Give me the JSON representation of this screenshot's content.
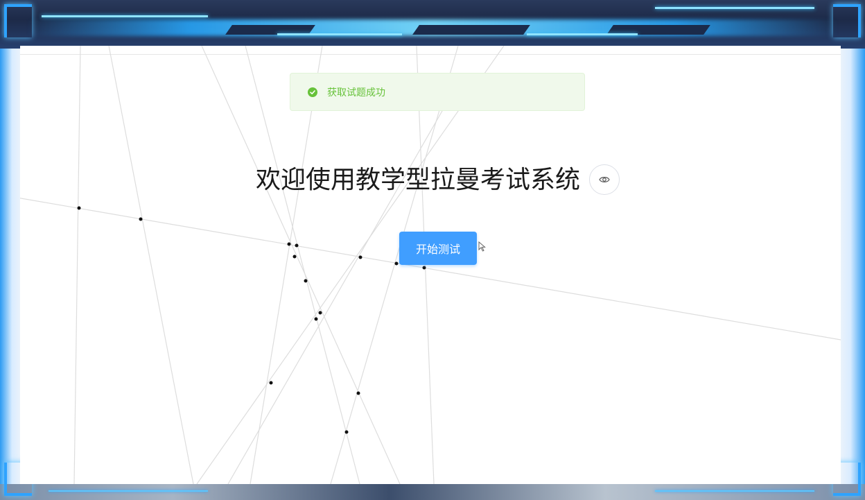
{
  "toast": {
    "message": "获取试题成功",
    "icon": "check-circle-icon",
    "color": "#67c23a"
  },
  "main": {
    "title": "欢迎使用教学型拉曼考试系统",
    "visibility_icon": "eye-icon",
    "start_button_label": "开始测试"
  },
  "colors": {
    "primary": "#409eff",
    "frame_accent": "#2ea3ff"
  }
}
